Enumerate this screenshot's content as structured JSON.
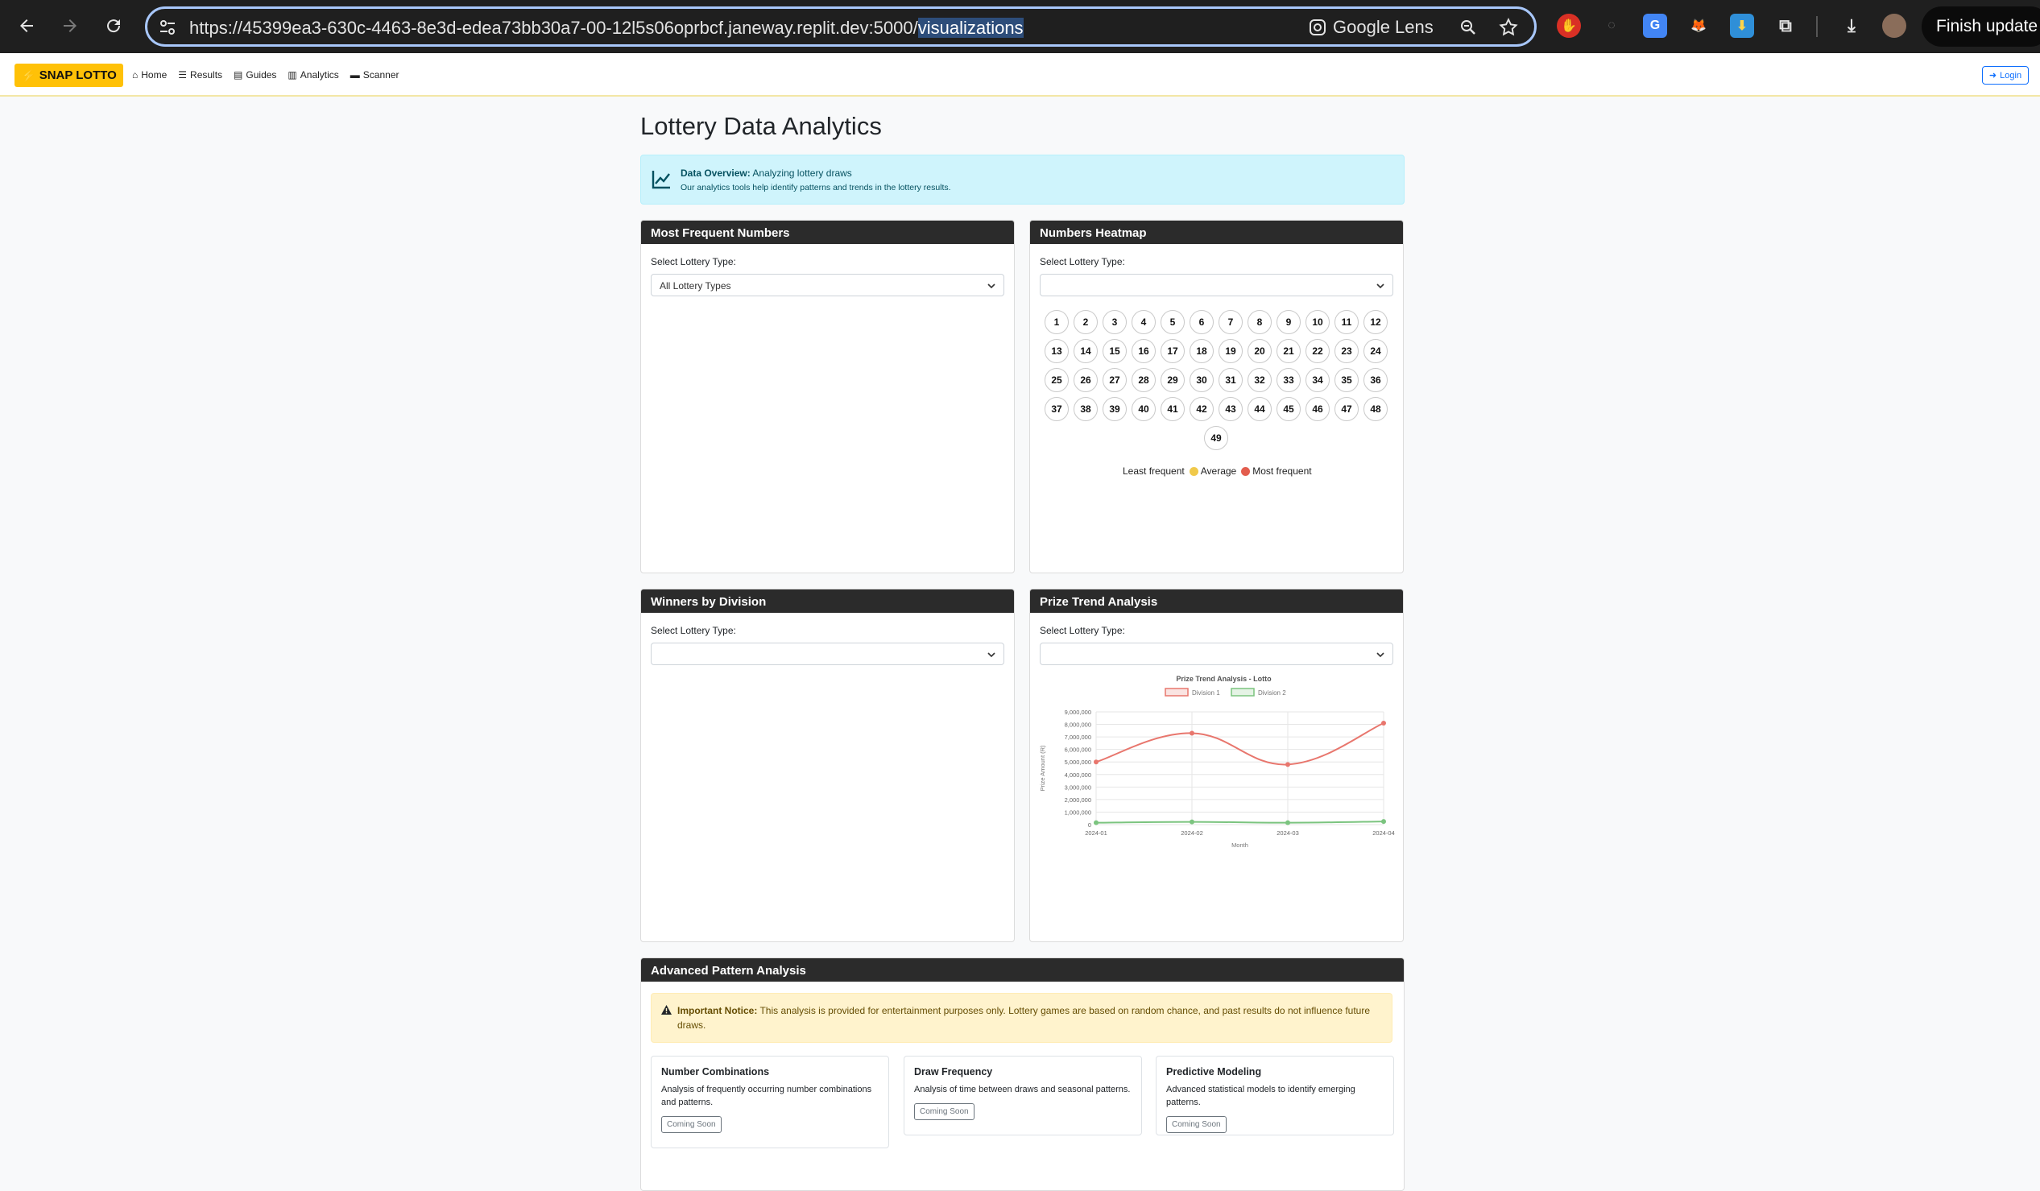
{
  "browser": {
    "url_main": "https://45399ea3-630c-4463-8e3d-edea73bb30a7-00-12l5s06oprbcf.janeway.replit.dev:5000/",
    "url_selected": "visualizations",
    "lens_label": "Google Lens",
    "finish_update_label": "Finish update"
  },
  "navbar": {
    "brand": "SNAP LOTTO",
    "links": [
      "Home",
      "Results",
      "Guides",
      "Analytics",
      "Scanner"
    ],
    "login": "Login"
  },
  "page": {
    "title": "Lottery Data Analytics",
    "overview_label": "Data Overview:",
    "overview_text": "Analyzing lottery draws",
    "overview_sub": "Our analytics tools help identify patterns and trends in the lottery results."
  },
  "most_frequent": {
    "header": "Most Frequent Numbers",
    "select_label": "Select Lottery Type:",
    "select_value": "All Lottery Types"
  },
  "heatmap": {
    "header": "Numbers Heatmap",
    "select_label": "Select Lottery Type:",
    "select_value": "",
    "numbers": [
      "1",
      "2",
      "3",
      "4",
      "5",
      "6",
      "7",
      "8",
      "9",
      "10",
      "11",
      "12",
      "13",
      "14",
      "15",
      "16",
      "17",
      "18",
      "19",
      "20",
      "21",
      "22",
      "23",
      "24",
      "25",
      "26",
      "27",
      "28",
      "29",
      "30",
      "31",
      "32",
      "33",
      "34",
      "35",
      "36",
      "37",
      "38",
      "39",
      "40",
      "41",
      "42",
      "43",
      "44",
      "45",
      "46",
      "47",
      "48",
      "49"
    ],
    "legend": {
      "least": "Least frequent",
      "average": "Average",
      "most": "Most frequent"
    },
    "colors": {
      "average": "#f0c94a",
      "most": "#e35d4e"
    }
  },
  "winners": {
    "header": "Winners by Division",
    "select_label": "Select Lottery Type:",
    "select_value": ""
  },
  "prize_trend": {
    "header": "Prize Trend Analysis",
    "select_label": "Select Lottery Type:",
    "select_value": ""
  },
  "chart_data": {
    "type": "line",
    "title": "Prize Trend Analysis - Lotto",
    "xlabel": "Month",
    "ylabel": "Prize Amount (R)",
    "x": [
      "2024-01",
      "2024-02",
      "2024-03",
      "2024-04"
    ],
    "ylim": [
      0,
      9000000
    ],
    "yticks": [
      "0",
      "1,000,000",
      "2,000,000",
      "3,000,000",
      "4,000,000",
      "5,000,000",
      "6,000,000",
      "7,000,000",
      "8,000,000",
      "9,000,000"
    ],
    "legend_position": "top",
    "grid": true,
    "series": [
      {
        "name": "Division 1",
        "color": "#e8766d",
        "values": [
          5000000,
          7300000,
          4800000,
          8100000
        ]
      },
      {
        "name": "Division 2",
        "color": "#7bc47f",
        "values": [
          150000,
          220000,
          150000,
          250000
        ]
      }
    ]
  },
  "advanced": {
    "header": "Advanced Pattern Analysis",
    "notice_label": "Important Notice:",
    "notice_text": "This analysis is provided for entertainment purposes only. Lottery games are based on random chance, and past results do not influence future draws.",
    "cards": [
      {
        "title": "Number Combinations",
        "text": "Analysis of frequently occurring number combinations and patterns.",
        "button": "Coming Soon"
      },
      {
        "title": "Draw Frequency",
        "text": "Analysis of time between draws and seasonal patterns.",
        "button": "Coming Soon"
      },
      {
        "title": "Predictive Modeling",
        "text": "Advanced statistical models to identify emerging patterns.",
        "button": "Coming Soon"
      }
    ]
  }
}
